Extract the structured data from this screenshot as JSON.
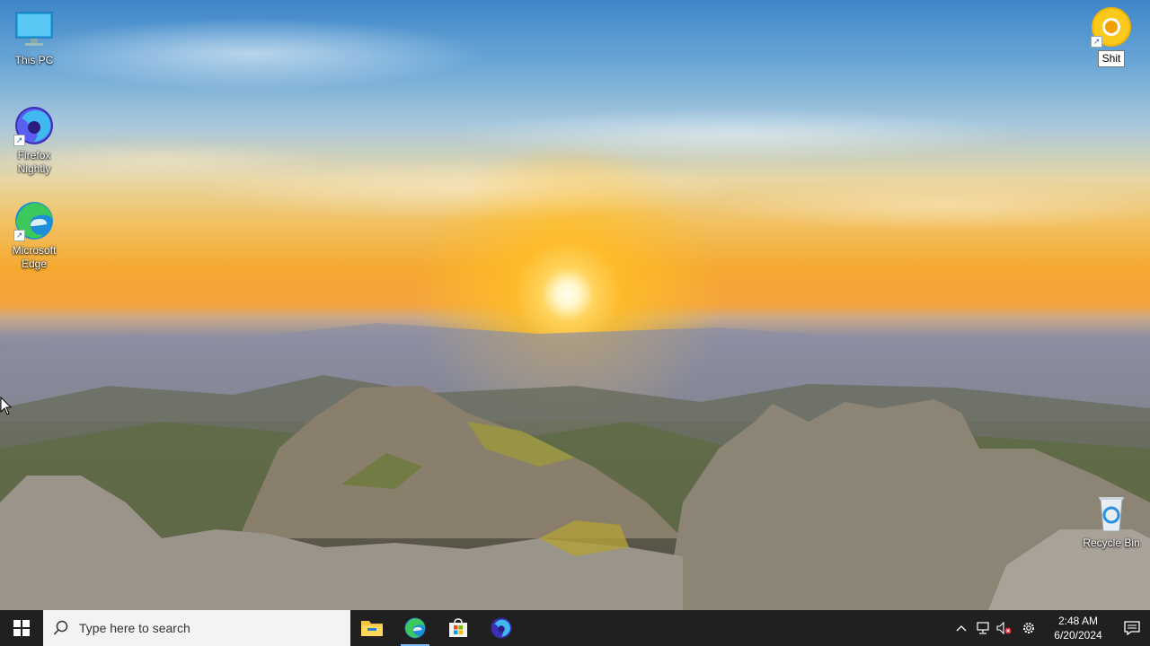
{
  "desktop": {
    "icons": [
      {
        "label": "This PC",
        "icon": "this-pc-icon"
      },
      {
        "label": "Firefox Nightly",
        "line1": "Firefox",
        "line2": "Nightly",
        "icon": "firefox-nightly-icon"
      },
      {
        "label": "Microsoft Edge",
        "line1": "Microsoft",
        "line2": "Edge",
        "icon": "edge-icon"
      },
      {
        "label": "Shit",
        "icon": "chrome-canary-icon"
      },
      {
        "label": "Recycle Bin",
        "icon": "recycle-bin-icon"
      }
    ]
  },
  "taskbar": {
    "search_placeholder": "Type here to search",
    "pinned": [
      {
        "name": "File Explorer",
        "icon": "file-explorer-icon"
      },
      {
        "name": "Microsoft Edge",
        "icon": "edge-icon",
        "active": true
      },
      {
        "name": "Microsoft Store",
        "icon": "store-icon"
      },
      {
        "name": "Firefox Nightly",
        "icon": "firefox-nightly-icon"
      }
    ],
    "clock": {
      "time": "2:48 AM",
      "date": "6/20/2024"
    }
  },
  "colors": {
    "taskbar_bg": "#202020",
    "search_bg": "#f3f3f3",
    "active_indicator": "#7cb9f2"
  }
}
